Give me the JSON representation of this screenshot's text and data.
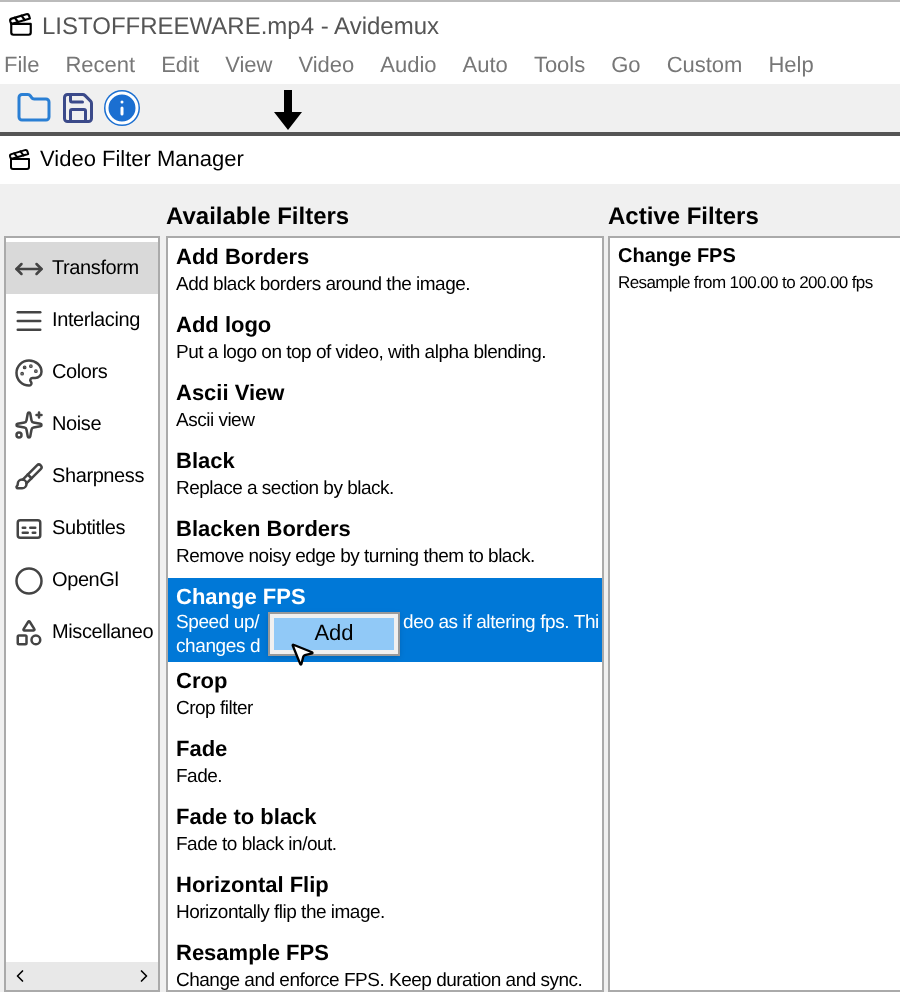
{
  "window": {
    "title": "LISTOFFREEWARE.mp4 - Avidemux"
  },
  "menu": [
    "File",
    "Recent",
    "Edit",
    "View",
    "Video",
    "Audio",
    "Auto",
    "Tools",
    "Go",
    "Custom",
    "Help"
  ],
  "dialog": {
    "title": "Video Filter Manager"
  },
  "categories": [
    {
      "label": "Transform",
      "selected": true
    },
    {
      "label": "Interlacing",
      "selected": false
    },
    {
      "label": "Colors",
      "selected": false
    },
    {
      "label": "Noise",
      "selected": false
    },
    {
      "label": "Sharpness",
      "selected": false
    },
    {
      "label": "Subtitles",
      "selected": false
    },
    {
      "label": "OpenGl",
      "selected": false
    },
    {
      "label": "Miscellaneo",
      "selected": false
    }
  ],
  "available": {
    "heading": "Available Filters",
    "items": [
      {
        "name": "Add Borders",
        "description": "Add black borders around the image.",
        "selected": false
      },
      {
        "name": "Add logo",
        "description": "Put a logo on top of video, with alpha blending.",
        "selected": false
      },
      {
        "name": "Ascii View",
        "description": "Ascii view",
        "selected": false
      },
      {
        "name": "Black",
        "description": "Replace a section by black.",
        "selected": false
      },
      {
        "name": "Blacken Borders",
        "description": "Remove noisy edge by turning them to black.",
        "selected": false
      },
      {
        "name": "Change FPS",
        "description_parts": [
          "Speed up/",
          "deo as if altering fps. Thi",
          "changes d"
        ],
        "selected": true,
        "popup": "Add"
      },
      {
        "name": "Crop",
        "description": "Crop filter",
        "selected": false
      },
      {
        "name": "Fade",
        "description": "Fade.",
        "selected": false
      },
      {
        "name": "Fade to black",
        "description": "Fade to black in/out.",
        "selected": false
      },
      {
        "name": "Horizontal Flip",
        "description": "Horizontally flip the image.",
        "selected": false
      },
      {
        "name": "Resample FPS",
        "description": "Change and enforce FPS. Keep duration and sync.",
        "selected": false
      }
    ]
  },
  "active": {
    "heading": "Active Filters",
    "items": [
      {
        "name": "Change FPS",
        "description": "Resample from 100.00 to 200.00 fps"
      }
    ]
  }
}
